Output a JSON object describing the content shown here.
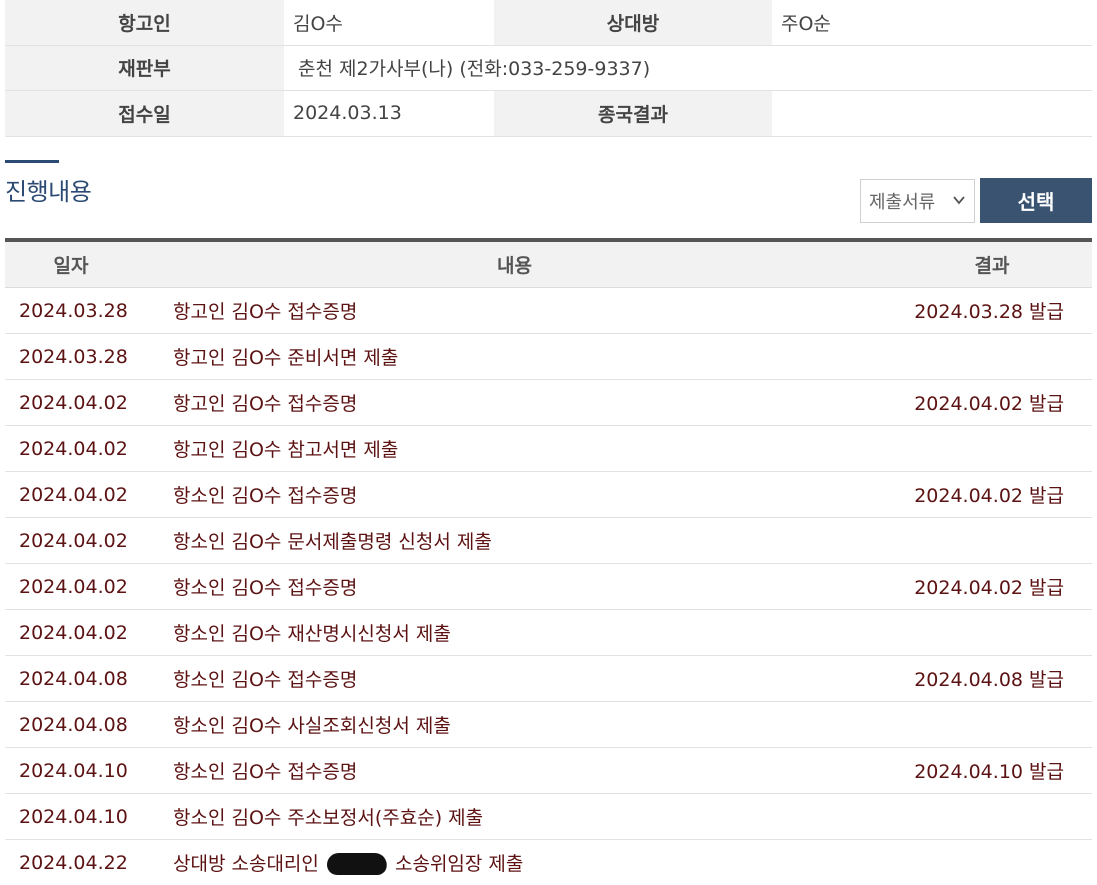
{
  "info": {
    "rows": [
      {
        "label1": "항고인",
        "value1": "김O수",
        "label2": "상대방",
        "value2": "주O순"
      },
      {
        "label1": "재판부",
        "value_wide": "춘천 제2가사부(나) (전화:033-259-9337)"
      },
      {
        "label1": "접수일",
        "value1": "2024.03.13",
        "label2": "종국결과",
        "value2": ""
      }
    ]
  },
  "section": {
    "title": "진행내용"
  },
  "filter": {
    "selected": "제출서류",
    "button": "선택"
  },
  "table": {
    "headers": {
      "date": "일자",
      "content": "내용",
      "result": "결과"
    },
    "rows": [
      {
        "date": "2024.03.28",
        "content": "항고인 김O수 접수증명",
        "result": "2024.03.28 발급"
      },
      {
        "date": "2024.03.28",
        "content": "항고인 김O수 준비서면 제출",
        "result": ""
      },
      {
        "date": "2024.04.02",
        "content": "항고인 김O수 접수증명",
        "result": "2024.04.02 발급"
      },
      {
        "date": "2024.04.02",
        "content": "항고인 김O수 참고서면 제출",
        "result": ""
      },
      {
        "date": "2024.04.02",
        "content": "항소인 김O수 접수증명",
        "result": "2024.04.02 발급"
      },
      {
        "date": "2024.04.02",
        "content": "항소인 김O수 문서제출명령 신청서 제출",
        "result": ""
      },
      {
        "date": "2024.04.02",
        "content": "항소인 김O수 접수증명",
        "result": "2024.04.02 발급"
      },
      {
        "date": "2024.04.02",
        "content": "항소인 김O수 재산명시신청서 제출",
        "result": ""
      },
      {
        "date": "2024.04.08",
        "content": "항소인 김O수 접수증명",
        "result": "2024.04.08 발급"
      },
      {
        "date": "2024.04.08",
        "content": "항소인 김O수 사실조회신청서 제출",
        "result": ""
      },
      {
        "date": "2024.04.10",
        "content": "항소인 김O수 접수증명",
        "result": "2024.04.10 발급"
      },
      {
        "date": "2024.04.10",
        "content": "항소인 김O수 주소보정서(주효순) 제출",
        "result": ""
      },
      {
        "date": "2024.04.22",
        "content_pre": "상대방 소송대리인",
        "content_post": "소송위임장 제출",
        "result": ""
      }
    ]
  }
}
